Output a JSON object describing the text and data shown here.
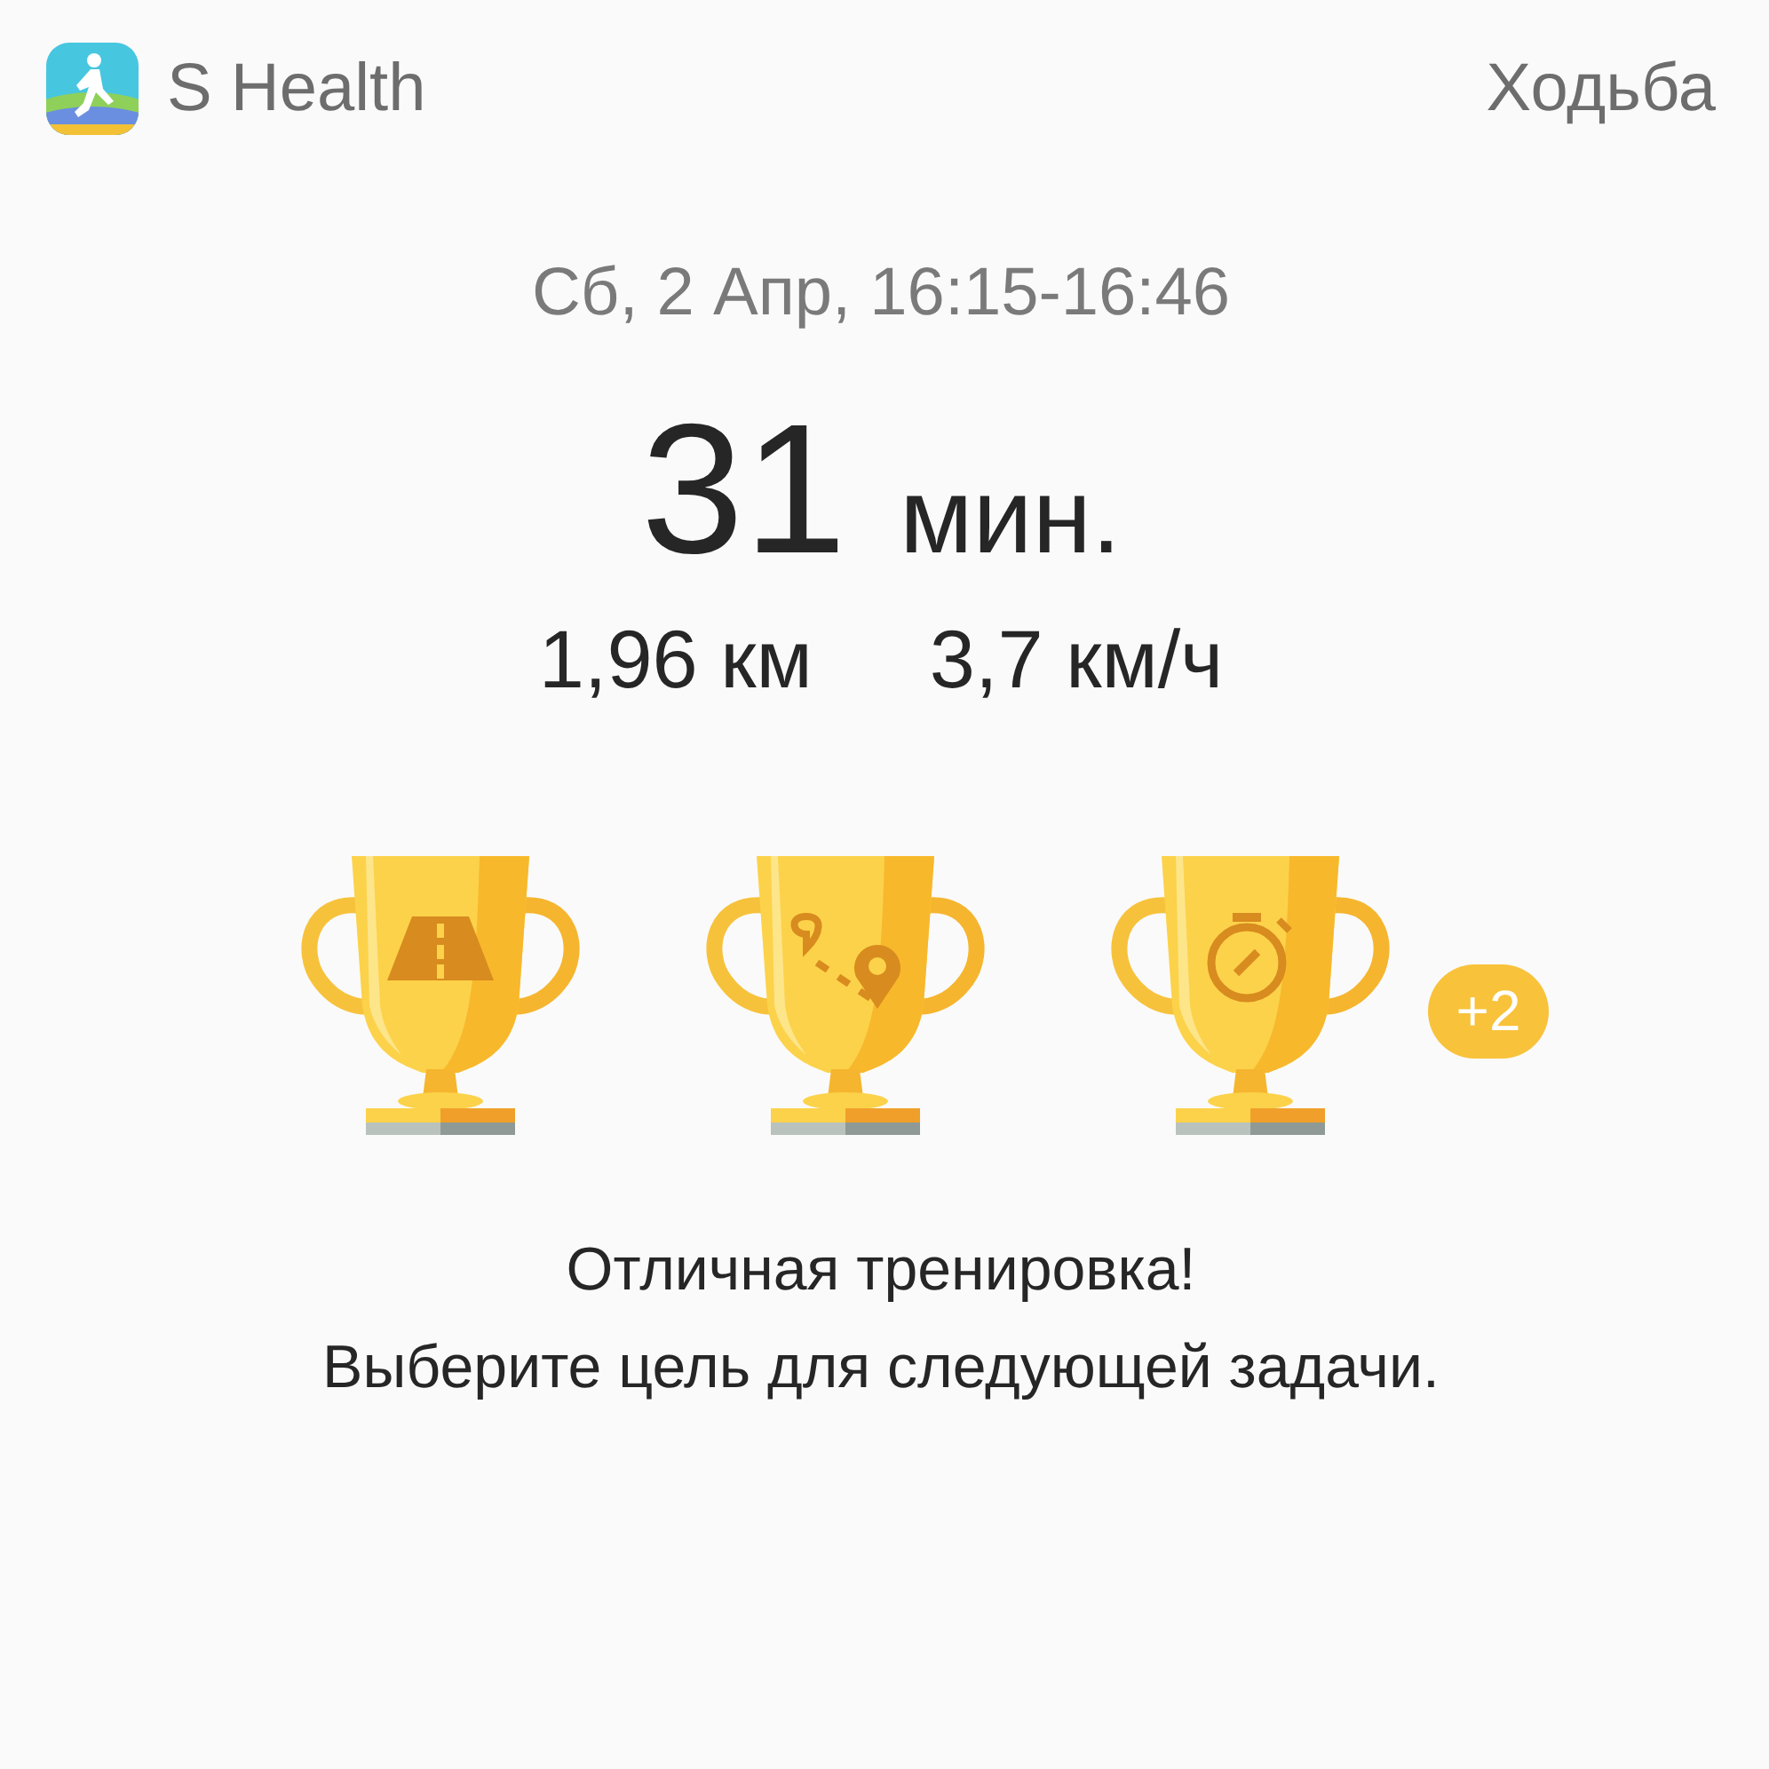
{
  "app": {
    "name": "S Health"
  },
  "activity": "Ходьба",
  "date": "Сб, 2 Апр, 16:15-16:46",
  "duration": {
    "value": "31",
    "unit": "мин."
  },
  "stats": [
    "1,96 км",
    "3,7 км/ч"
  ],
  "trophies": [
    {
      "kind": "road"
    },
    {
      "kind": "route"
    },
    {
      "kind": "timer"
    }
  ],
  "more_badge": "+2",
  "message": [
    "Отличная тренировка!",
    "Выберите цель для следующей задачи."
  ]
}
